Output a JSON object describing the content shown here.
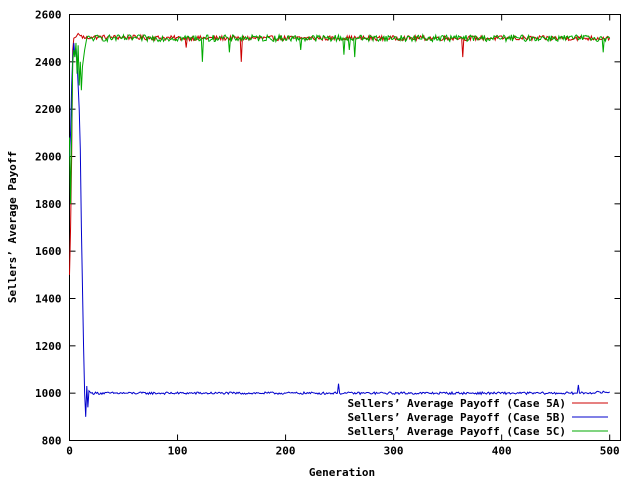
{
  "chart_data": {
    "type": "line",
    "xlabel": "Generation",
    "ylabel": "Sellers’ Average Payoff",
    "xlim": [
      0,
      510
    ],
    "ylim": [
      800,
      2600
    ],
    "xticks": [
      0,
      100,
      200,
      300,
      400,
      500
    ],
    "yticks": [
      800,
      1000,
      1200,
      1400,
      1600,
      1800,
      2000,
      2200,
      2400,
      2600
    ],
    "legend_position": "bottom-right",
    "grid": false,
    "series": [
      {
        "name": "Sellers’ Average Payoff (Case 5A)",
        "color": "#cc0000",
        "anchors": [
          [
            0,
            1500
          ],
          [
            1,
            1700
          ],
          [
            2,
            2000
          ],
          [
            3,
            2450
          ],
          [
            4,
            2500
          ],
          [
            6,
            2505
          ],
          [
            8,
            2520
          ],
          [
            10,
            2510
          ],
          [
            15,
            2500
          ],
          [
            20,
            2505
          ],
          [
            107,
            2500
          ],
          [
            108,
            2460
          ],
          [
            109,
            2500
          ],
          [
            158,
            2500
          ],
          [
            159,
            2400
          ],
          [
            160,
            2500
          ],
          [
            363,
            2500
          ],
          [
            364,
            2420
          ],
          [
            365,
            2500
          ],
          [
            500,
            2500
          ]
        ],
        "base": 2500,
        "noise": 10
      },
      {
        "name": "Sellers’ Average Payoff (Case 5B)",
        "color": "#0000cc",
        "anchors": [
          [
            0,
            2000
          ],
          [
            1,
            2100
          ],
          [
            2,
            2300
          ],
          [
            3,
            2420
          ],
          [
            4,
            2480
          ],
          [
            5,
            2420
          ],
          [
            6,
            2460
          ],
          [
            7,
            2400
          ],
          [
            8,
            2300
          ],
          [
            9,
            2200
          ],
          [
            10,
            2030
          ],
          [
            11,
            1700
          ],
          [
            12,
            1450
          ],
          [
            13,
            1200
          ],
          [
            14,
            1000
          ],
          [
            15,
            900
          ],
          [
            16,
            1030
          ],
          [
            17,
            940
          ],
          [
            18,
            1010
          ],
          [
            20,
            1000
          ],
          [
            248,
            1000
          ],
          [
            249,
            1040
          ],
          [
            250,
            1000
          ],
          [
            470,
            1000
          ],
          [
            471,
            1035
          ],
          [
            472,
            1000
          ],
          [
            500,
            1005
          ]
        ],
        "base": 1000,
        "noise": 5
      },
      {
        "name": "Sellers’ Average Payoff (Case 5C)",
        "color": "#00aa00",
        "anchors": [
          [
            0,
            2080
          ],
          [
            1,
            1800
          ],
          [
            2,
            2100
          ],
          [
            3,
            2400
          ],
          [
            4,
            2450
          ],
          [
            5,
            2420
          ],
          [
            6,
            2480
          ],
          [
            7,
            2350
          ],
          [
            8,
            2470
          ],
          [
            9,
            2300
          ],
          [
            10,
            2400
          ],
          [
            11,
            2280
          ],
          [
            12,
            2380
          ],
          [
            14,
            2450
          ],
          [
            16,
            2500
          ],
          [
            20,
            2500
          ],
          [
            122,
            2500
          ],
          [
            123,
            2400
          ],
          [
            124,
            2500
          ],
          [
            147,
            2500
          ],
          [
            148,
            2440
          ],
          [
            149,
            2500
          ],
          [
            213,
            2500
          ],
          [
            214,
            2450
          ],
          [
            215,
            2500
          ],
          [
            253,
            2500
          ],
          [
            254,
            2430
          ],
          [
            255,
            2500
          ],
          [
            258,
            2500
          ],
          [
            259,
            2450
          ],
          [
            260,
            2500
          ],
          [
            263,
            2500
          ],
          [
            264,
            2420
          ],
          [
            265,
            2500
          ],
          [
            493,
            2500
          ],
          [
            494,
            2440
          ],
          [
            495,
            2500
          ],
          [
            500,
            2500
          ]
        ],
        "base": 2500,
        "noise": 14
      }
    ]
  }
}
